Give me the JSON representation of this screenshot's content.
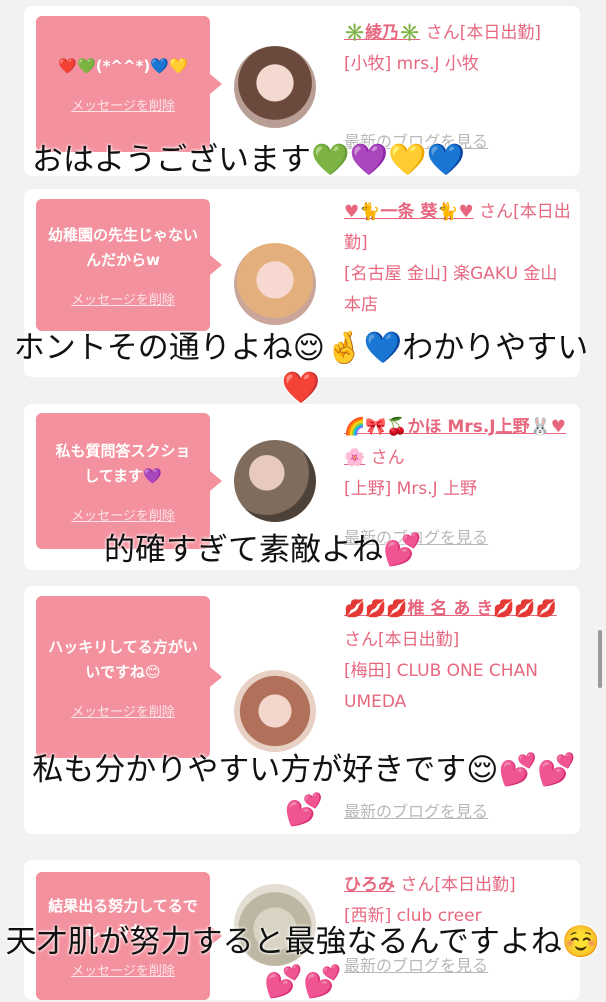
{
  "delete_label": "メッセージを削除",
  "blog_label": "最新のブログを見る",
  "posts": [
    {
      "message": "❤️💚(*^^*)💙💛",
      "name": "✳️綾乃✳️",
      "suffix": " さん[本日出勤]",
      "shop": "[小牧] mrs.J 小牧",
      "overlay": "おはようございます💚💜💛💙"
    },
    {
      "message": "幼稚園の先生じゃないんだからw",
      "name": "♥🐈一条 葵🐈♥",
      "suffix": " さん[本日出勤]",
      "shop": "[名古屋 金山] 楽GAKU 金山本店",
      "overlay": "ホントその通りよね😌🤞💙わかりやすい❤️"
    },
    {
      "message": "私も質問答スクショしてます💜",
      "name": "🌈🎀🍒かほ Mrs.J上野🐰♥🌸",
      "suffix": " さん",
      "shop": "[上野] Mrs.J 上野",
      "overlay": "的確すぎて素敵よね💕"
    },
    {
      "message": "ハッキリしてる方がいいですね😊",
      "name": "💋💋💋椎 名 あ き💋💋💋",
      "suffix": " さん[本日出勤]",
      "shop": "[梅田] CLUB ONE CHAN UMEDA",
      "overlay": "私も分かりやすい方が好きです😌💕💕💕"
    },
    {
      "message": "結果出る努力してるでしょうねぇ",
      "name": "ひろみ",
      "suffix": " さん[本日出勤]",
      "shop": "[西新] club creer",
      "overlay": "天才肌が努力すると最強なるんですよね☺️💕💕"
    }
  ]
}
